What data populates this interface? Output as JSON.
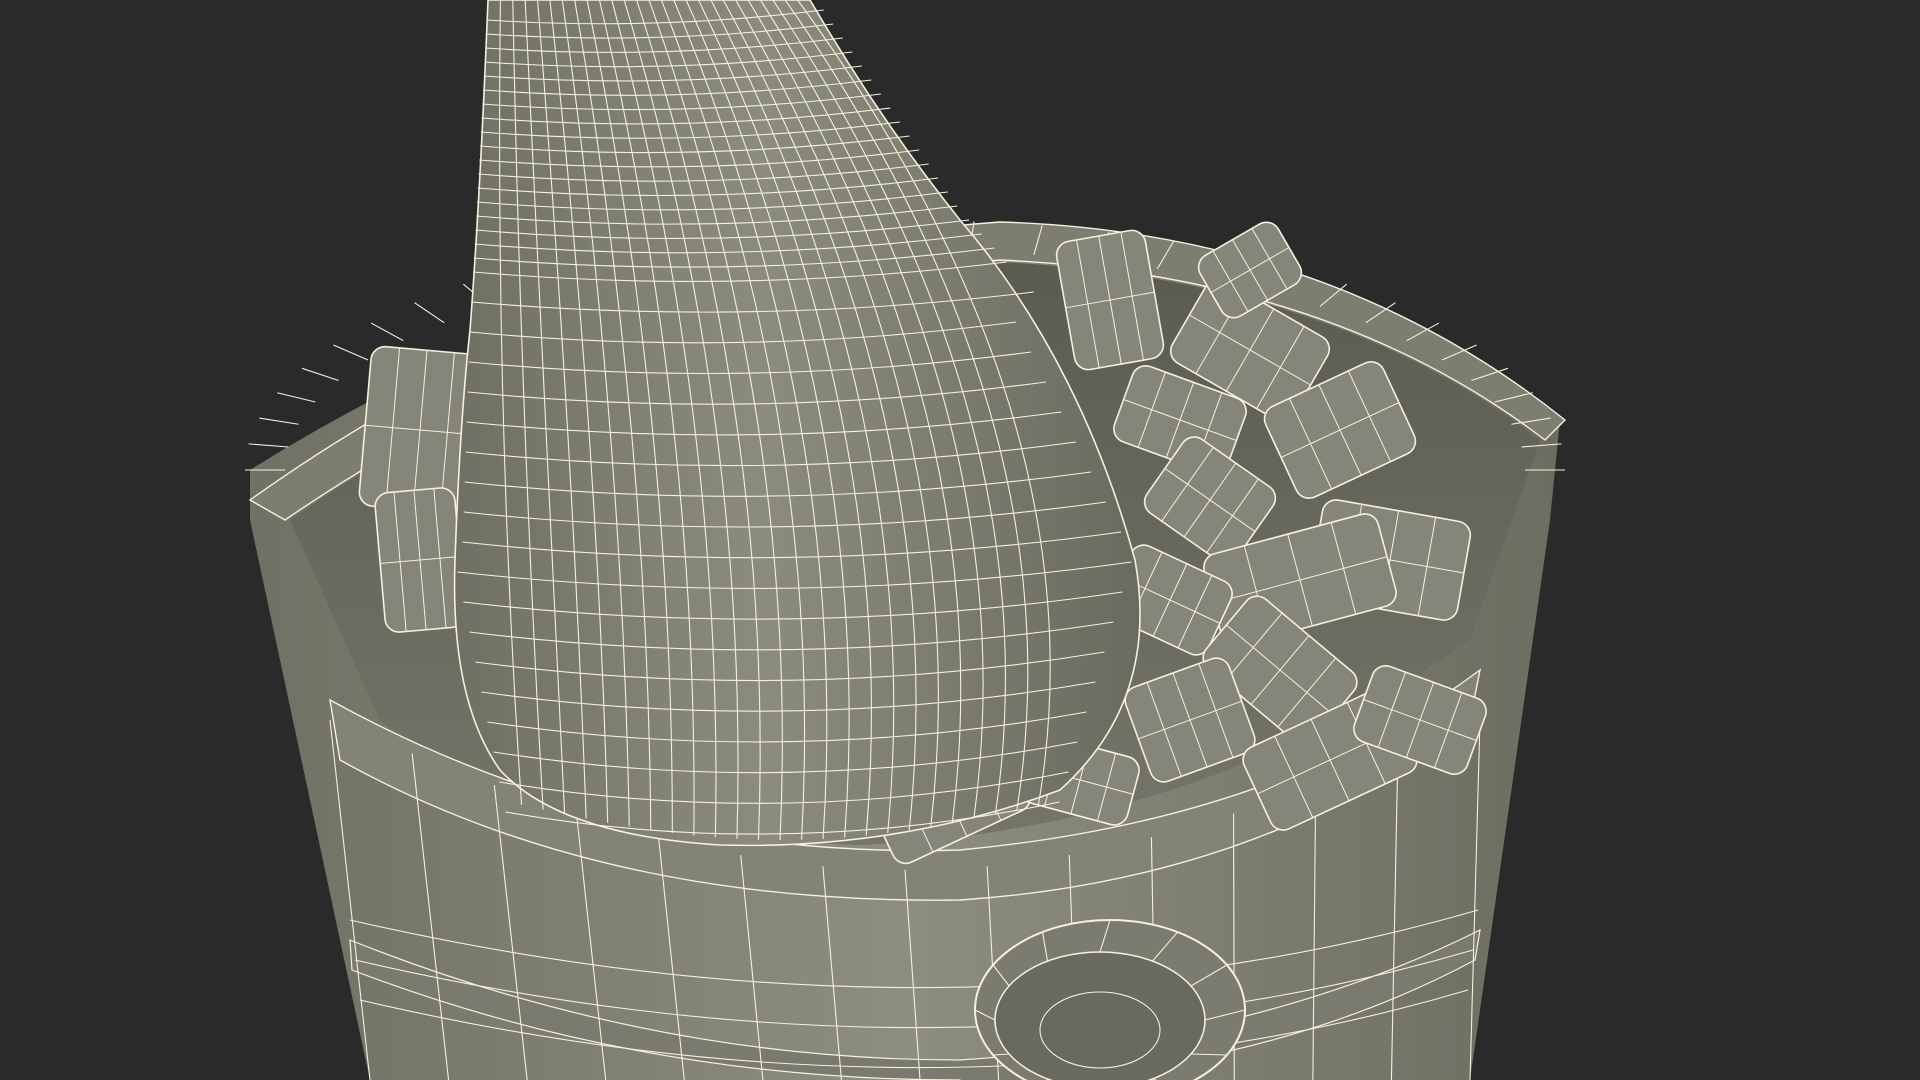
{
  "scene": {
    "background_color": "#2a2a2b",
    "surface_color": "#8a8a7b",
    "surface_shadow_color": "#5e5e54",
    "wire_color": "#f4f1de",
    "objects": [
      "wine-bottle",
      "ice-bucket",
      "ice-cubes",
      "bucket-handle"
    ]
  }
}
